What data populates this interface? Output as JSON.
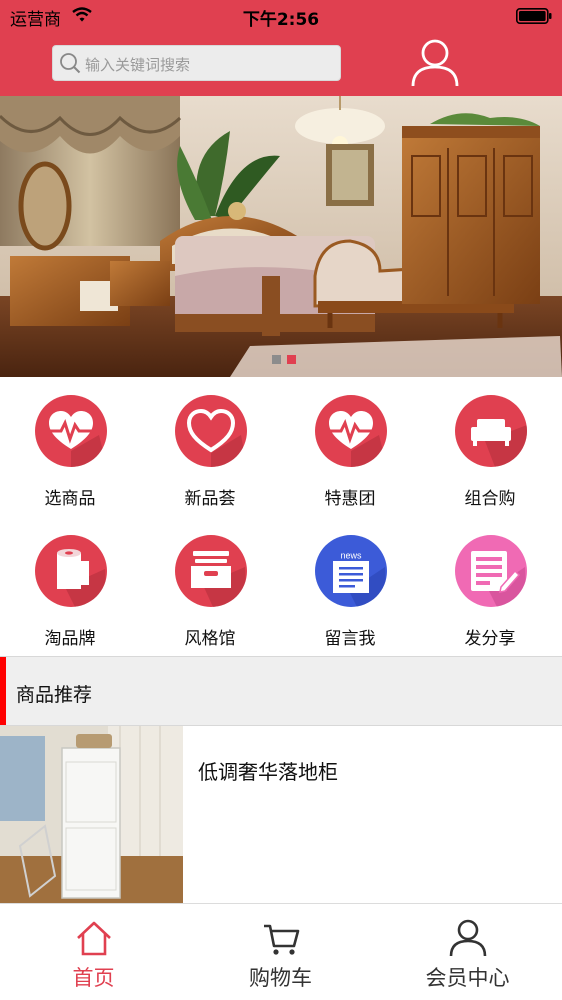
{
  "status_bar": {
    "carrier": "运营商",
    "time": "下午2:56"
  },
  "header": {
    "search_placeholder": "输入关键词搜索",
    "accent_color": "#e04050"
  },
  "banner": {
    "slide_count": 2,
    "active_slide": 2
  },
  "categories": [
    {
      "label": "选商品",
      "icon": "heartbeat-icon",
      "color": "#e04050"
    },
    {
      "label": "新品荟",
      "icon": "heart-icon",
      "color": "#e04050"
    },
    {
      "label": "特惠团",
      "icon": "heartbeat-icon",
      "color": "#e04050"
    },
    {
      "label": "组合购",
      "icon": "sofa-icon",
      "color": "#e04050"
    },
    {
      "label": "淘品牌",
      "icon": "tissue-roll-icon",
      "color": "#e04050"
    },
    {
      "label": "风格馆",
      "icon": "file-drawer-icon",
      "color": "#e04050"
    },
    {
      "label": "留言我",
      "icon": "news-icon",
      "color": "#3c5bd8",
      "icon_text": "news"
    },
    {
      "label": "发分享",
      "icon": "share-form-icon",
      "color": "#f06ab4"
    }
  ],
  "section": {
    "title": "商品推荐",
    "bar_color": "#ff0000"
  },
  "products": [
    {
      "name": "低调奢华落地柜"
    }
  ],
  "tabs": [
    {
      "label": "首页",
      "icon": "home-icon",
      "active": true
    },
    {
      "label": "购物车",
      "icon": "cart-icon",
      "active": false
    },
    {
      "label": "会员中心",
      "icon": "user-icon",
      "active": false
    }
  ],
  "tab_active_color": "#e04050",
  "tab_inactive_color": "#333333"
}
